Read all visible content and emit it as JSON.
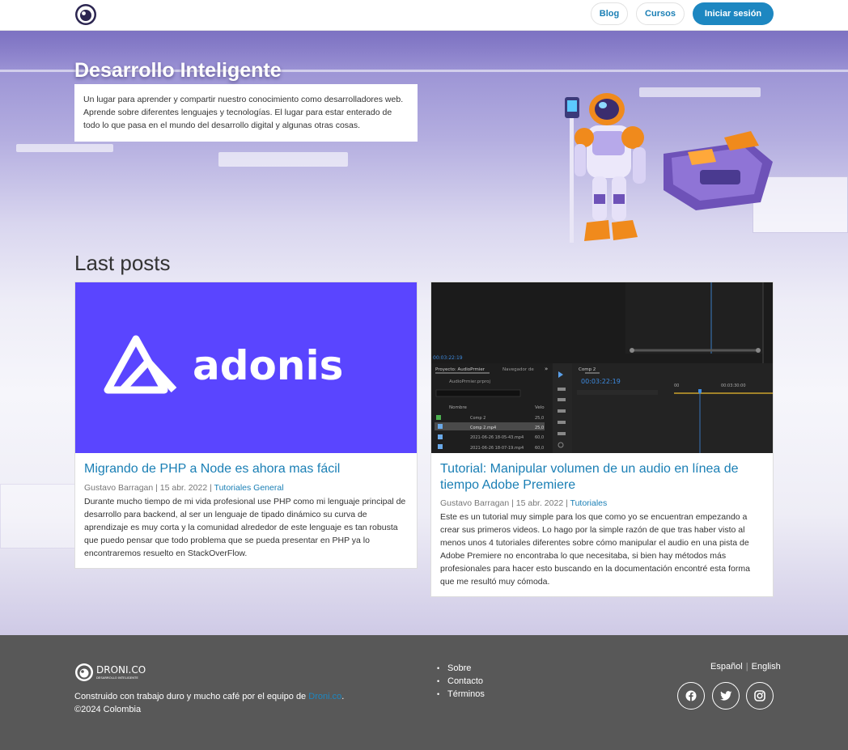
{
  "nav": {
    "logo_icon": "eye-logo-icon",
    "blog_label": "Blog",
    "cursos_label": "Cursos",
    "login_label": "Iniciar sesión"
  },
  "hero": {
    "title": "Desarrollo Inteligente",
    "description": "Un lugar para aprender y compartir nuestro conocimiento como desarrolladores web. Aprende sobre diferentes lenguajes y tecnologías. El lugar para estar enterado de todo lo que pasa en el mundo del desarrollo digital y algunas otras cosas.",
    "illustration": "astronaut-robot-illustration"
  },
  "posts": {
    "heading": "Last posts",
    "items": [
      {
        "image_text": "adonis",
        "title": "Migrando de PHP a Node es ahora mas fácil",
        "author_date": "Gustavo Barragan | 15 abr. 2022 |",
        "tags": "Tutoriales General",
        "excerpt": "Durante mucho tiempo de mi vida profesional use PHP como mi lenguaje principal de desarrollo para backend, al ser un lenguaje de tipado dinámico su curva de aprendizaje es muy corta y la comunidad alrededor de este lenguaje es tan robusta que puedo pensar que todo problema que se pueda presentar en PHP ya lo encontraremos resuelto en StackOverFlow."
      },
      {
        "image_text": {
          "timecode": "00:03:22:19",
          "timecode_small": "00:03:22:19",
          "project_tab": "Proyecto: AudioPrmier",
          "nav_tab": "Navegador de",
          "project_file": "AudioPrmier.prproj",
          "column_name": "Nombre",
          "column_speed": "Velo",
          "seq_tab": "Comp 2",
          "ruler_start": "00",
          "ruler_mid": "00:03:30:00",
          "files": [
            {
              "name": "Comp 2",
              "rate": "25,0"
            },
            {
              "name": "Comp 2.mp4",
              "rate": "25,0"
            },
            {
              "name": "2021-06-26 18-05-43.mp4",
              "rate": "60,0"
            },
            {
              "name": "2021-06-26 18-07-19.mp4",
              "rate": "60,0"
            }
          ]
        },
        "title": "Tutorial: Manipular volumen de un audio en línea de tiempo Adobe Premiere",
        "author_date": "Gustavo Barragan | 15 abr. 2022 |",
        "tags": "Tutoriales",
        "excerpt": "Este es un tutorial muy simple para los que como yo se encuentran empezando a crear sus primeros videos. Lo hago por la simple razón de que tras haber visto al menos unos 4 tutoriales diferentes sobre cómo manipular el audio en una pista de Adobe Premiere no encontraba lo que necesitaba, si bien hay métodos más profesionales para hacer esto buscando en la documentación encontré esta forma que me resultó muy cómoda."
      }
    ]
  },
  "footer": {
    "logo_text": "DRONI.CO",
    "logo_subtext": "DESARROLLO INTELIGENTE",
    "built_prefix": "Construido con trabajo duro y mucho café por el equipo de",
    "built_link": "Droni.co",
    "built_suffix": ".",
    "copyright": "©2024 Colombia",
    "links": [
      "Sobre",
      "Contacto",
      "Términos"
    ],
    "lang_es": "Español",
    "lang_sep": "|",
    "lang_en": "English",
    "social": [
      "facebook-icon",
      "twitter-icon",
      "instagram-icon"
    ]
  },
  "colors": {
    "accent": "#1d87c1",
    "adonis_bg": "#5a45ff",
    "footer_bg": "#585858"
  }
}
